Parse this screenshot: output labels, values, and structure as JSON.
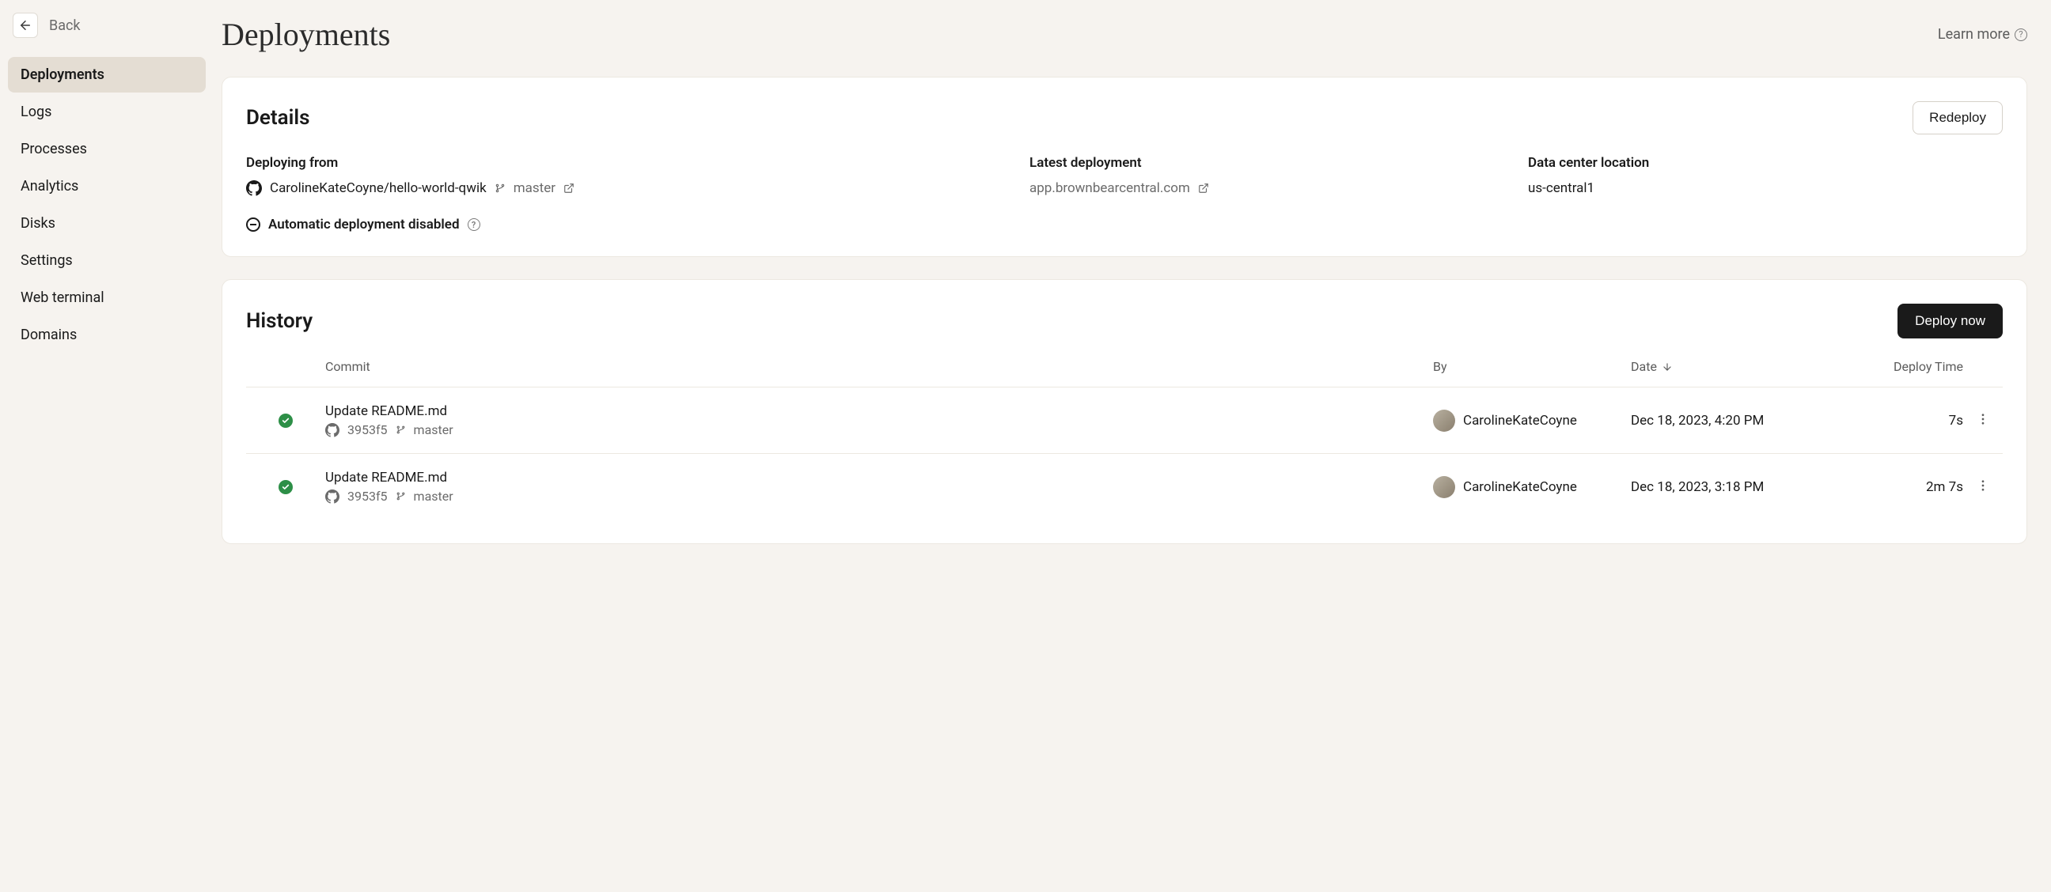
{
  "back_label": "Back",
  "page_title": "Deployments",
  "learn_more_label": "Learn more",
  "sidebar": {
    "items": [
      {
        "label": "Deployments",
        "active": true
      },
      {
        "label": "Logs",
        "active": false
      },
      {
        "label": "Processes",
        "active": false
      },
      {
        "label": "Analytics",
        "active": false
      },
      {
        "label": "Disks",
        "active": false
      },
      {
        "label": "Settings",
        "active": false
      },
      {
        "label": "Web terminal",
        "active": false
      },
      {
        "label": "Domains",
        "active": false
      }
    ]
  },
  "details": {
    "title": "Details",
    "redeploy_label": "Redeploy",
    "deploying_from_label": "Deploying from",
    "repo": "CarolineKateCoyne/hello-world-qwik",
    "branch": "master",
    "latest_deployment_label": "Latest deployment",
    "latest_deployment_url": "app.brownbearcentral.com",
    "data_center_label": "Data center location",
    "data_center_value": "us-central1",
    "auto_deploy_text": "Automatic deployment disabled"
  },
  "history": {
    "title": "History",
    "deploy_now_label": "Deploy now",
    "columns": {
      "commit": "Commit",
      "by": "By",
      "date": "Date",
      "deploy_time": "Deploy Time"
    },
    "rows": [
      {
        "commit_msg": "Update README.md",
        "commit_hash": "3953f5",
        "branch": "master",
        "by": "CarolineKateCoyne",
        "date": "Dec 18, 2023, 4:20 PM",
        "deploy_time": "7s"
      },
      {
        "commit_msg": "Update README.md",
        "commit_hash": "3953f5",
        "branch": "master",
        "by": "CarolineKateCoyne",
        "date": "Dec 18, 2023, 3:18 PM",
        "deploy_time": "2m 7s"
      }
    ]
  }
}
